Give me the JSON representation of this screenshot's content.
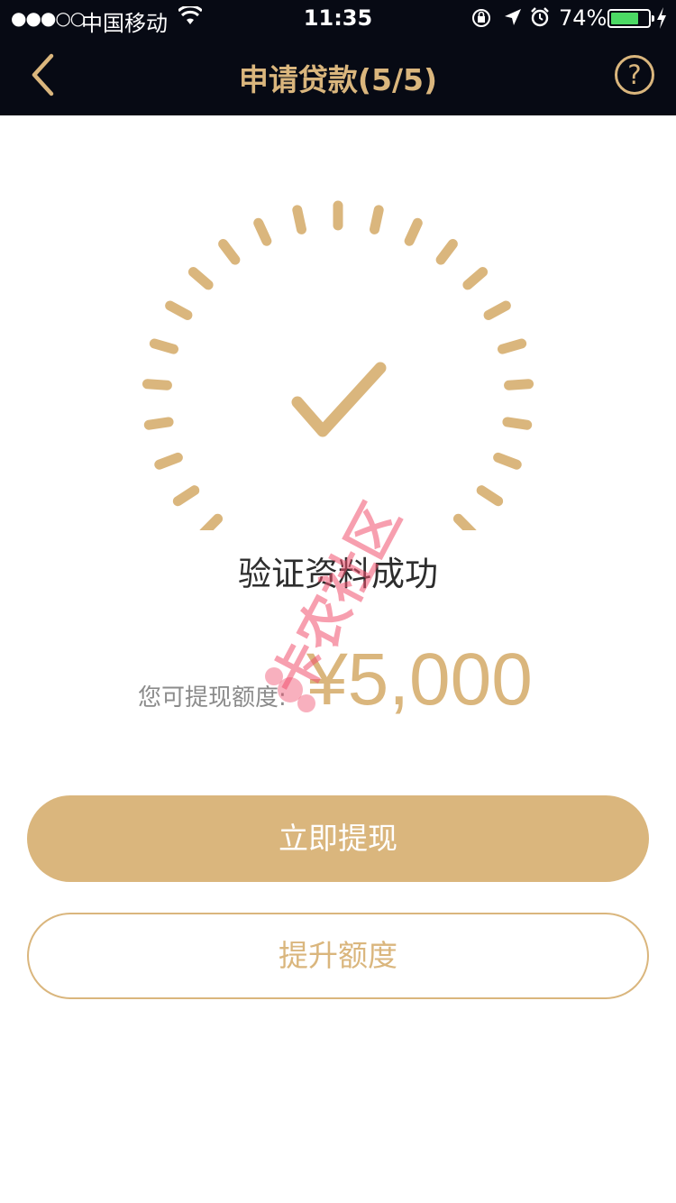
{
  "status_bar": {
    "signal": "●●●○○",
    "carrier": "中国移动",
    "time": "11:35",
    "battery_percent": "74%",
    "battery_level": 0.74,
    "icons": [
      "wifi-icon",
      "rotation-lock-icon",
      "location-arrow-icon",
      "alarm-icon",
      "battery-icon",
      "charging-bolt-icon"
    ]
  },
  "nav": {
    "title": "申请贷款(5/5)",
    "back_icon": "chevron-left-icon",
    "help_label": "?"
  },
  "result": {
    "icon": "checkmark-icon",
    "message": "验证资料成功",
    "amount_label": "您可提现额度:",
    "amount_value": "¥5,000"
  },
  "actions": {
    "withdraw_label": "立即提现",
    "raise_limit_label": "提升额度"
  },
  "colors": {
    "accent": "#dab67d",
    "header_bg": "#070a14",
    "text_dark": "#2d2d2d",
    "text_muted": "#8b8b8b",
    "watermark": "#f0506e"
  },
  "watermark": {
    "text": "卡农社区"
  }
}
